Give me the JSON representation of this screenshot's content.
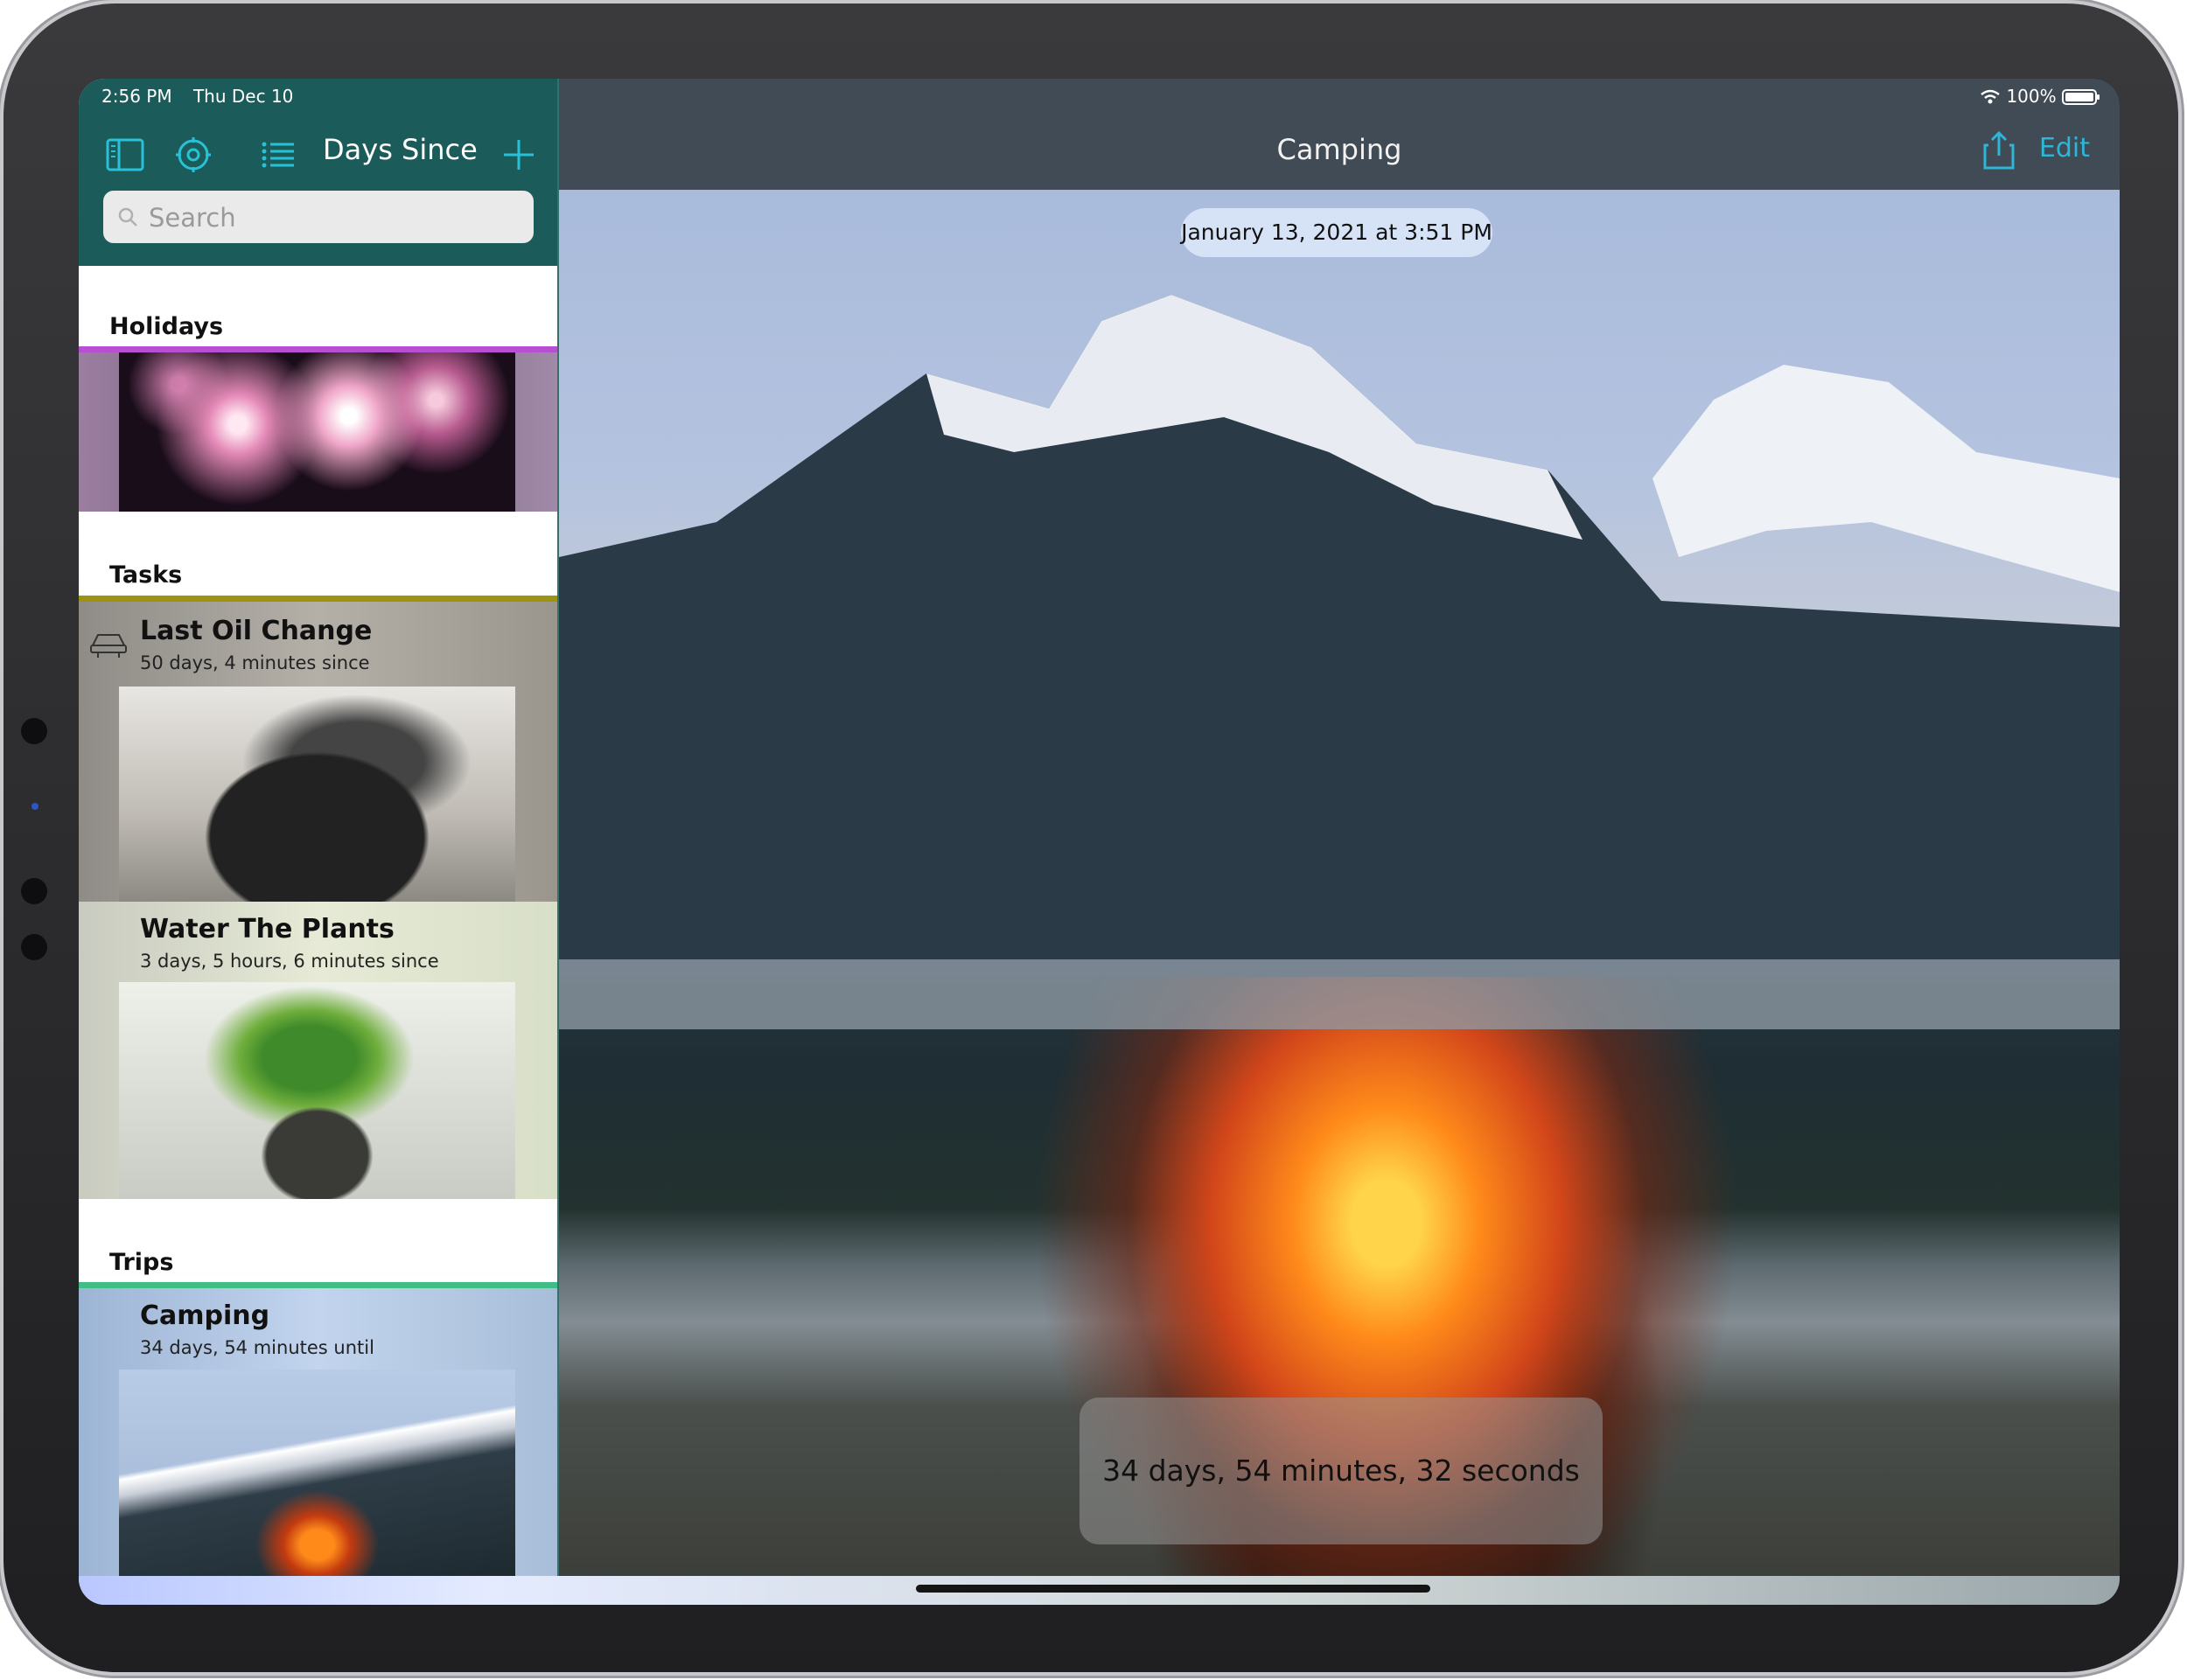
{
  "status": {
    "time": "2:56 PM",
    "date": "Thu Dec 10",
    "battery": "100%"
  },
  "sidebar": {
    "title": "Days Since",
    "search_placeholder": "Search",
    "sections": [
      {
        "title": "Holidays",
        "accent": "#b84ed2"
      },
      {
        "title": "Tasks",
        "accent": "#9c9410",
        "items": [
          {
            "title": "Last Oil Change",
            "subtitle": "50 days, 4 minutes since"
          },
          {
            "title": "Water The Plants",
            "subtitle": "3 days, 5 hours, 6 minutes since"
          }
        ]
      },
      {
        "title": "Trips",
        "accent": "#3fbf86",
        "items": [
          {
            "title": "Camping",
            "subtitle": "34 days, 54 minutes until"
          }
        ]
      }
    ]
  },
  "detail": {
    "title": "Camping",
    "edit_label": "Edit",
    "date": "January 13, 2021 at 3:51 PM",
    "countdown": "34 days, 54 minutes, 32 seconds until"
  },
  "colors": {
    "nav_bar": "#1b5c5a",
    "detail_bar": "#404b55",
    "tint": "#2db6d6"
  },
  "icons": [
    "sidebar-toggle-icon",
    "settings-icon",
    "list-icon",
    "plus-icon",
    "share-icon",
    "wifi-icon",
    "battery-icon",
    "car-icon",
    "search-icon"
  ]
}
